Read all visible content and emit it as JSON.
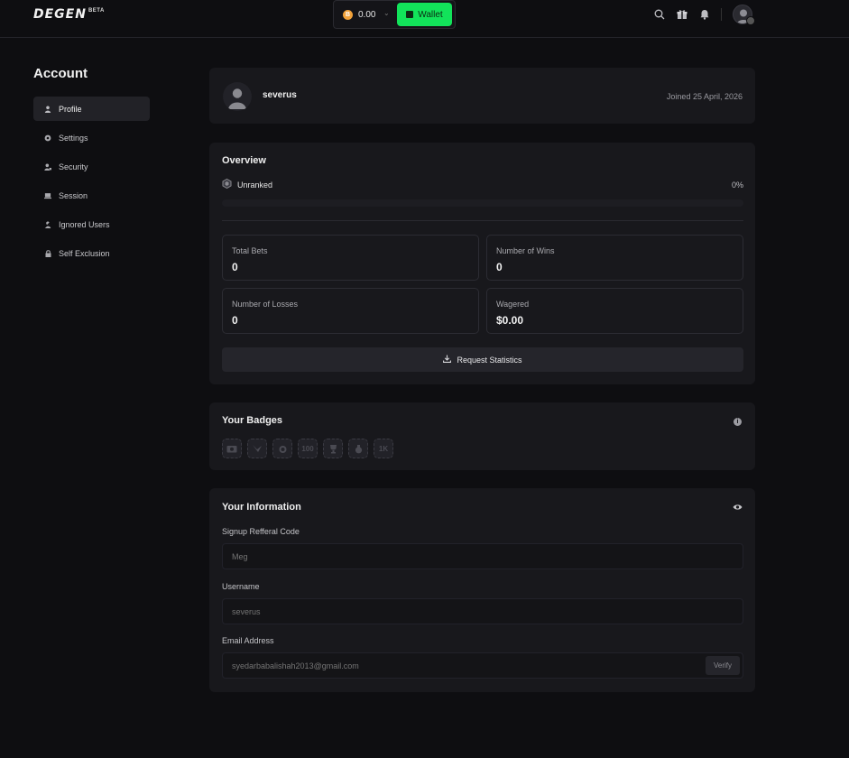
{
  "header": {
    "logo": "DEGEN",
    "logo_tag": "BETA",
    "coin_symbol": "B",
    "balance": "0.00",
    "wallet_label": "Wallet",
    "icons": [
      "search-icon",
      "gift-icon",
      "bell-icon",
      "avatar"
    ]
  },
  "sidebar": {
    "title": "Account",
    "items": [
      {
        "label": "Profile",
        "icon": "user-icon",
        "active": true
      },
      {
        "label": "Settings",
        "icon": "gear-icon"
      },
      {
        "label": "Security",
        "icon": "user-lock-icon"
      },
      {
        "label": "Session",
        "icon": "laptop-icon"
      },
      {
        "label": "Ignored Users",
        "icon": "user-slash-icon"
      },
      {
        "label": "Self Exclusion",
        "icon": "lock-icon"
      }
    ]
  },
  "profile": {
    "username": "severus",
    "joined": "Joined 25 April, 2026"
  },
  "overview": {
    "title": "Overview",
    "rank": "Unranked",
    "progress_pct": "0%",
    "progress_fraction": 0,
    "stats": [
      {
        "label": "Total Bets",
        "value": "0"
      },
      {
        "label": "Number of Wins",
        "value": "0"
      },
      {
        "label": "Number of Losses",
        "value": "0"
      },
      {
        "label": "Wagered",
        "value": "$0.00"
      }
    ],
    "request_label": "Request Statistics"
  },
  "badges": {
    "title": "Your Badges",
    "items": [
      "camera",
      "bird",
      "alarm",
      "100",
      "trophy",
      "bag",
      "1K"
    ],
    "visible_text": [
      "",
      "",
      "",
      "100",
      "",
      "",
      "1K"
    ]
  },
  "info": {
    "title": "Your Information",
    "fields": [
      {
        "label": "Signup Refferal Code",
        "placeholder": "Meg"
      },
      {
        "label": "Username",
        "placeholder": "severus"
      },
      {
        "label": "Email Address",
        "placeholder": "syedarbabalishah2013@gmail.com"
      }
    ],
    "verify_label": "Verify"
  },
  "colors": {
    "accent": "#12e35a",
    "background": "#0e0e11",
    "card": "#18181c"
  }
}
